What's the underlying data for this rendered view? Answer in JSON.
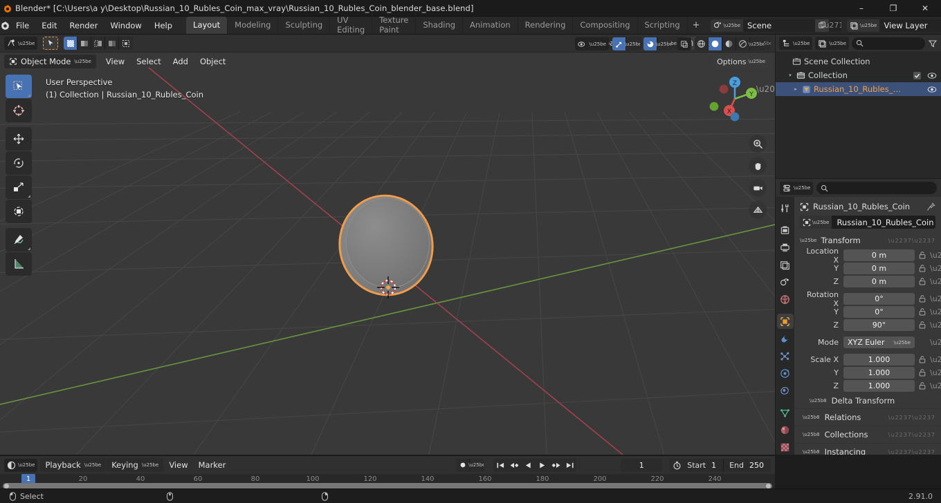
{
  "window": {
    "title": "Blender* [C:\\Users\\a y\\Desktop\\Russian_10_Rubles_Coin_max_vray\\Russian_10_Rubles_Coin_blender_base.blend]",
    "minimize": "–",
    "maximize": "❐",
    "close": "✕"
  },
  "topbar": {
    "menus": [
      "File",
      "Edit",
      "Render",
      "Window",
      "Help"
    ],
    "workspaces": [
      {
        "label": "Layout",
        "active": true
      },
      {
        "label": "Modeling",
        "active": false
      },
      {
        "label": "Sculpting",
        "active": false
      },
      {
        "label": "UV Editing",
        "active": false
      },
      {
        "label": "Texture Paint",
        "active": false
      },
      {
        "label": "Shading",
        "active": false
      },
      {
        "label": "Animation",
        "active": false
      },
      {
        "label": "Rendering",
        "active": false
      },
      {
        "label": "Compositing",
        "active": false
      },
      {
        "label": "Scripting",
        "active": false
      }
    ],
    "add_workspace": "+",
    "scene_name": "Scene",
    "view_layer_name": "View Layer"
  },
  "viewport": {
    "mode": "Object Mode",
    "menus": [
      "View",
      "Select",
      "Add",
      "Object"
    ],
    "transform_orientation": "Global",
    "options_label": "Options",
    "overlay_line1": "User Perspective",
    "overlay_line2": "(1) Collection | Russian_10_Rubles_Coin",
    "gizmo_axes": [
      "X",
      "Y",
      "Z"
    ],
    "tools": [
      "tweak-tool",
      "cursor-tool",
      "move-tool",
      "rotate-tool",
      "scale-tool",
      "transform-tool",
      "annotate-tool",
      "measure-tool"
    ]
  },
  "outliner": {
    "filter_placeholder": "",
    "rows": [
      {
        "label": "Scene Collection",
        "indent": 0,
        "icon": "collection-icon",
        "selected": false,
        "disclosure": "",
        "checkbox": false,
        "eye": false
      },
      {
        "label": "Collection",
        "indent": 1,
        "icon": "collection-icon",
        "selected": false,
        "disclosure": "▾",
        "checkbox": true,
        "eye": true
      },
      {
        "label": "Russian_10_Rubles_…",
        "indent": 2,
        "icon": "mesh-icon",
        "selected": true,
        "disclosure": "▸",
        "checkbox": false,
        "eye": true
      }
    ]
  },
  "properties": {
    "breadcrumb_object": "Russian_10_Rubles_Coin",
    "name_field_value": "Russian_10_Rubles_Coin",
    "transform_panel": "Transform",
    "rows": [
      {
        "label": "Location X",
        "value": "0 m"
      },
      {
        "label": "Y",
        "value": "0 m"
      },
      {
        "label": "Z",
        "value": "0 m"
      },
      {
        "label": "Rotation X",
        "value": "0°"
      },
      {
        "label": "Y",
        "value": "0°"
      },
      {
        "label": "Z",
        "value": "90°"
      }
    ],
    "mode_label": "Mode",
    "mode_value": "XYZ Euler",
    "scale_rows": [
      {
        "label": "Scale X",
        "value": "1.000"
      },
      {
        "label": "Y",
        "value": "1.000"
      },
      {
        "label": "Z",
        "value": "1.000"
      }
    ],
    "delta_transform": "Delta Transform",
    "closed_panels": [
      "Relations",
      "Collections",
      "Instancing"
    ],
    "tabs": [
      "tool-tab",
      "render-tab",
      "output-tab",
      "view-layer-tab",
      "scene-tab",
      "world-tab",
      "object-tab",
      "modifier-tab",
      "particles-tab",
      "physics-tab",
      "constraints-tab",
      "data-tab",
      "material-tab",
      "texture-tab"
    ]
  },
  "timeline": {
    "menus": [
      "Playback",
      "Keying",
      "View",
      "Marker"
    ],
    "current_frame": "1",
    "start_label": "Start",
    "start_value": "1",
    "end_label": "End",
    "end_value": "250",
    "ticks": [
      "20",
      "40",
      "60",
      "80",
      "100",
      "120",
      "140",
      "160",
      "180",
      "200",
      "220",
      "240"
    ],
    "playhead_frame": "1"
  },
  "statusbar": {
    "select_label": "Select",
    "version": "2.91.0"
  },
  "colors": {
    "accent_blue": "#4772b3",
    "select_orange": "#ed9e5c",
    "axis_x": "#a8414f",
    "axis_y": "#6a9b3f",
    "bg_dark": "#1d1d1d",
    "viewport_bg": "#393939"
  }
}
